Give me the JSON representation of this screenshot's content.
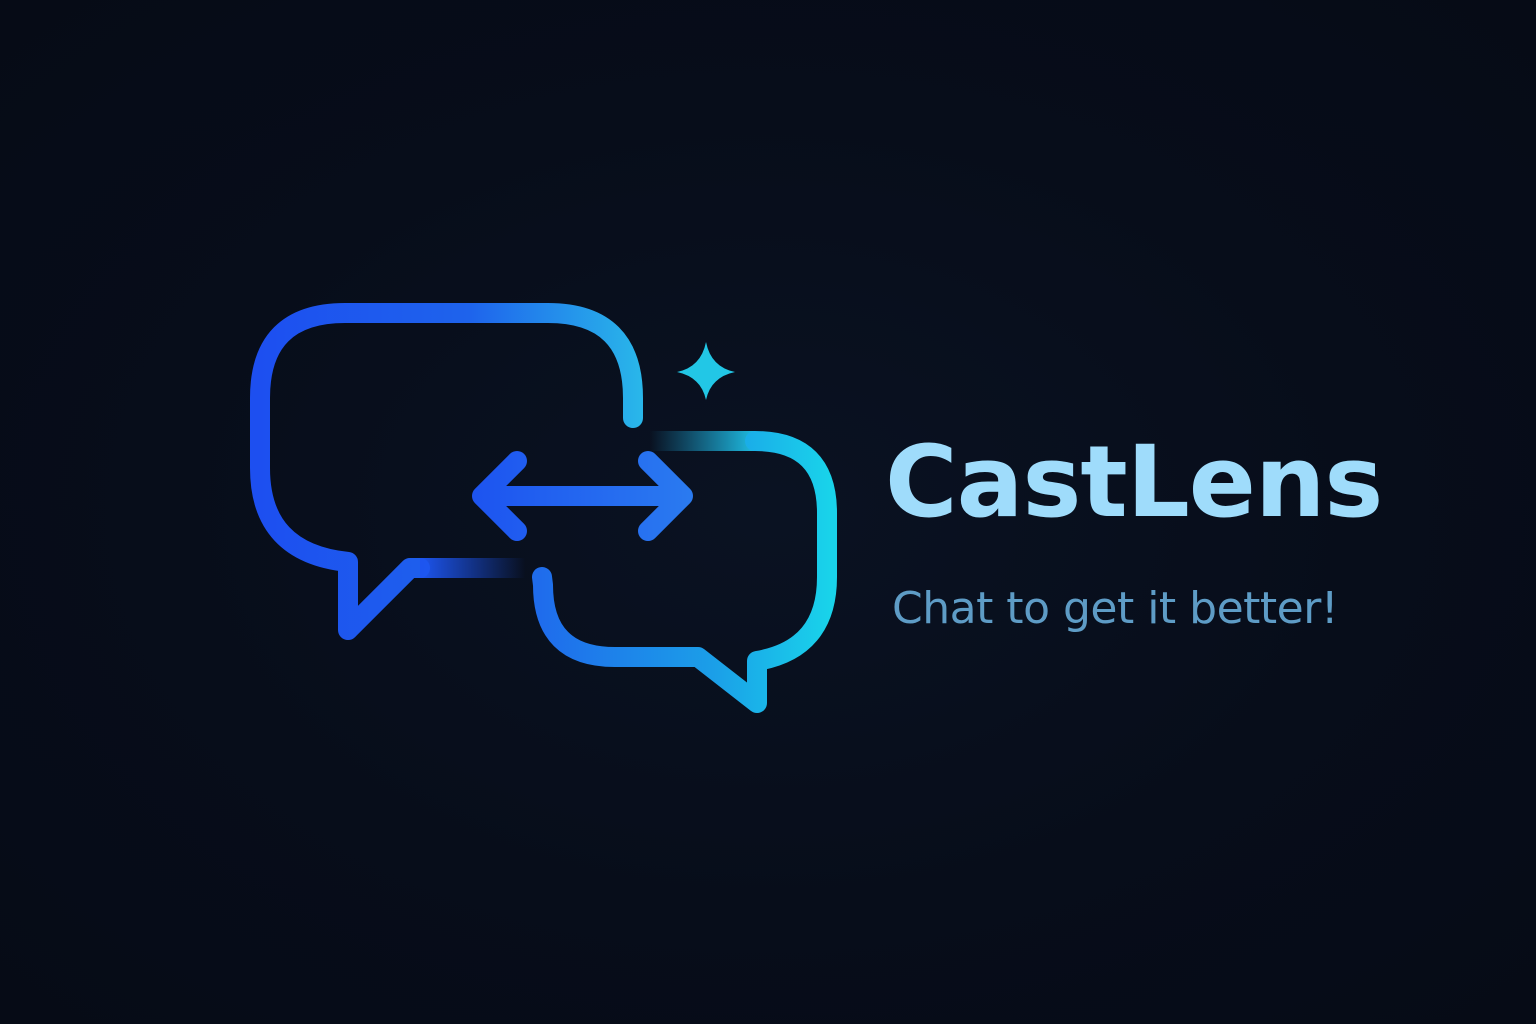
{
  "brand": {
    "name": "CastLens",
    "tagline": "Chat to get it better!"
  },
  "colors": {
    "background": "#070d1a",
    "gradient_start": "#1d4ff0",
    "gradient_end": "#19d3ea",
    "sparkle": "#22c7e6",
    "name_text": "#9fdcfb",
    "tagline_text": "#5e9cc6"
  },
  "icons": {
    "left_bubble": "chat-bubble-icon",
    "right_bubble": "chat-bubble-icon",
    "arrow": "double-arrow-icon",
    "sparkle": "sparkle-icon"
  }
}
